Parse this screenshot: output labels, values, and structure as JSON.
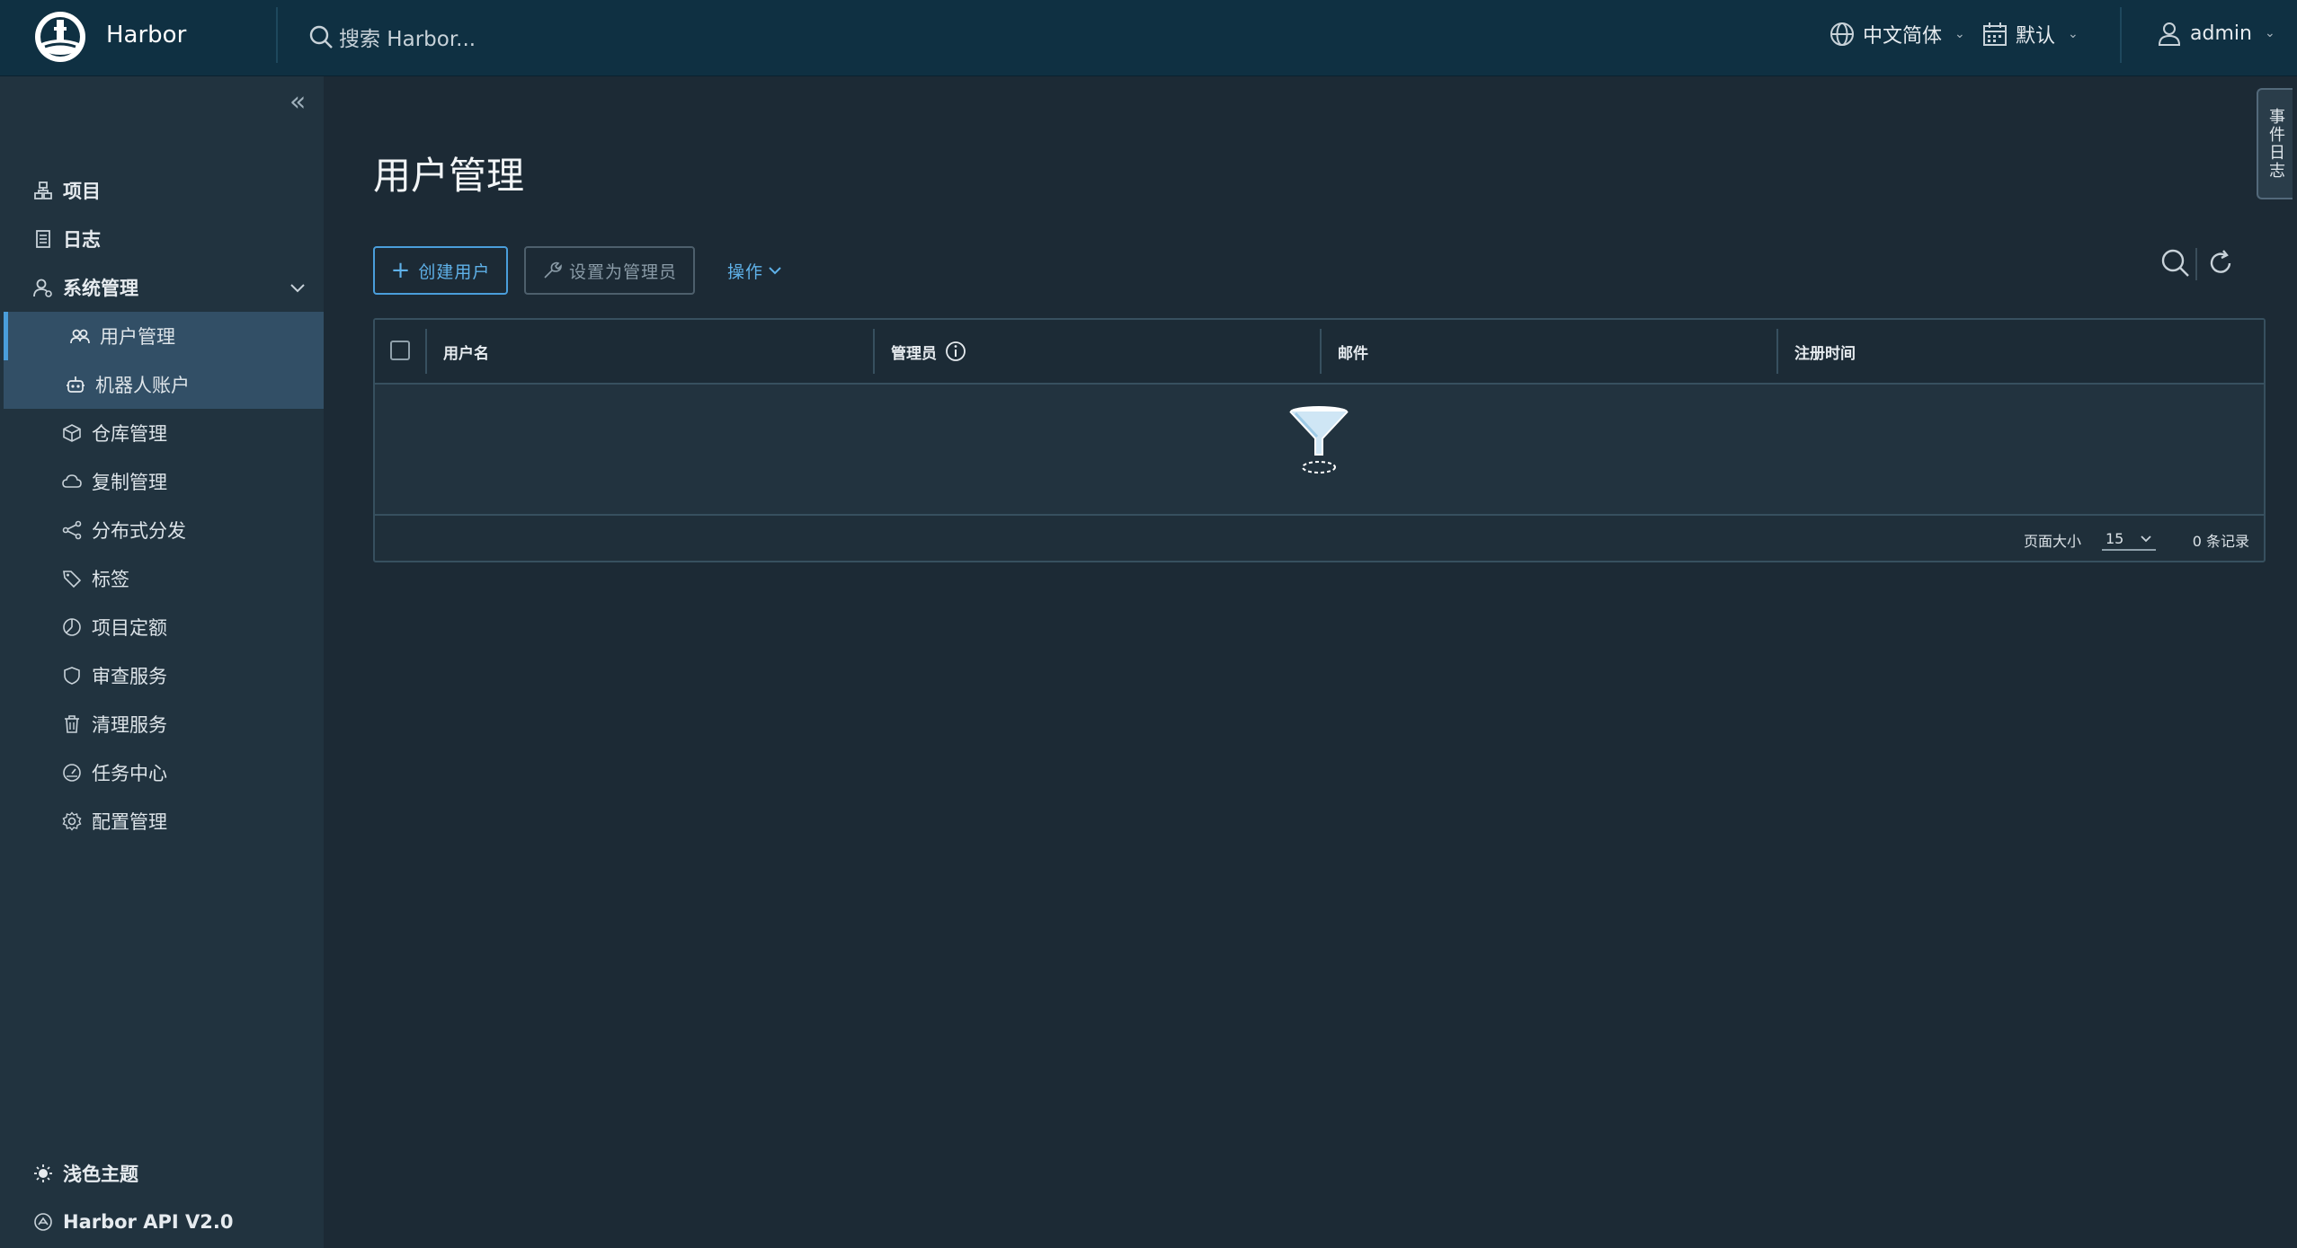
{
  "header": {
    "brand": "Harbor",
    "search_placeholder": "搜索 Harbor...",
    "language": "中文简体",
    "theme_setting": "默认",
    "user": "admin"
  },
  "sidebar": {
    "items": [
      {
        "label": "项目",
        "icon": "projects-icon"
      },
      {
        "label": "日志",
        "icon": "logs-icon"
      },
      {
        "label": "系统管理",
        "icon": "admin-icon"
      }
    ],
    "sub_items": [
      {
        "label": "用户管理",
        "icon": "users-icon"
      },
      {
        "label": "机器人账户",
        "icon": "robot-icon"
      },
      {
        "label": "仓库管理",
        "icon": "registry-icon"
      },
      {
        "label": "复制管理",
        "icon": "cloud-icon"
      },
      {
        "label": "分布式分发",
        "icon": "share-icon"
      },
      {
        "label": "标签",
        "icon": "tag-icon"
      },
      {
        "label": "项目定额",
        "icon": "quota-icon"
      },
      {
        "label": "审查服务",
        "icon": "shield-icon"
      },
      {
        "label": "清理服务",
        "icon": "trash-icon"
      },
      {
        "label": "任务中心",
        "icon": "dashboard-icon"
      },
      {
        "label": "配置管理",
        "icon": "gear-icon"
      }
    ],
    "bottom": [
      {
        "label": "浅色主题",
        "icon": "sun-icon"
      },
      {
        "label": "Harbor API V2.0",
        "icon": "api-icon"
      }
    ]
  },
  "main": {
    "title": "用户管理",
    "buttons": {
      "create_user": "创建用户",
      "set_admin": "设置为管理员",
      "actions": "操作"
    },
    "table": {
      "columns": [
        "用户名",
        "管理员",
        "邮件",
        "注册时间"
      ],
      "rows": [],
      "page_size_label": "页面大小",
      "page_size": "15",
      "records": "0 条记录"
    }
  },
  "side_tab": "事件日志",
  "colors": {
    "header_bg": "#0f3042",
    "sidebar_bg": "#21333f",
    "main_bg": "#1c2a35",
    "accent": "#4a9edb"
  }
}
